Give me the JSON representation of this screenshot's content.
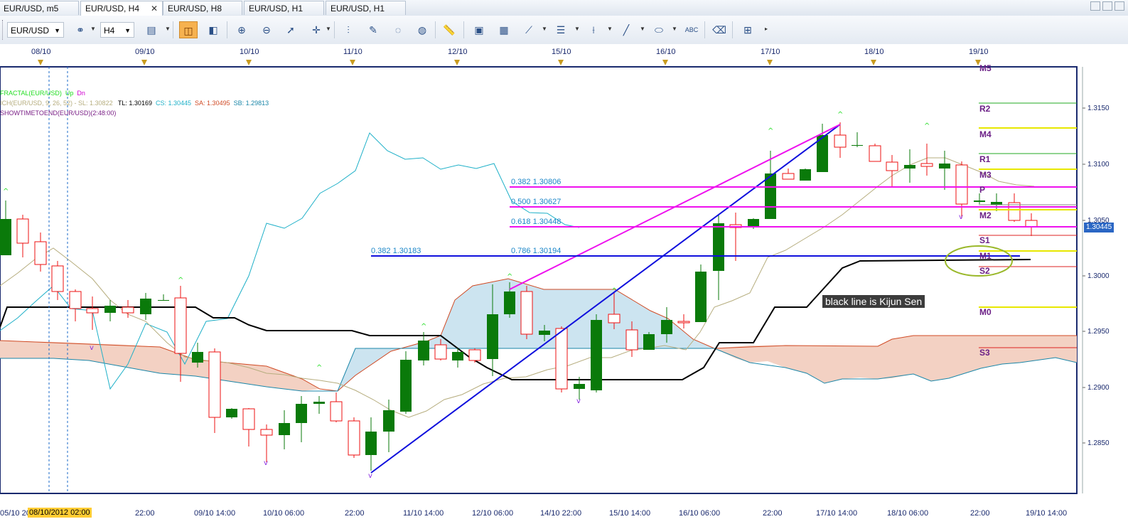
{
  "tabs": [
    {
      "label": "EUR/USD, m5",
      "active": false
    },
    {
      "label": "EUR/USD, H4",
      "active": true,
      "close": "✕"
    },
    {
      "label": "EUR/USD, H8",
      "active": false
    },
    {
      "label": "EUR/USD, H1",
      "active": false
    },
    {
      "label": "EUR/USD, H1",
      "active": false
    }
  ],
  "toolbar": {
    "symbol": "EUR/USD",
    "timeframe": "H4",
    "icons": [
      "link-icon",
      "chart-type-icon",
      "candles-icon",
      "bars-icon",
      "zoom-in-icon",
      "zoom-out-icon",
      "cursor-icon",
      "crosshair-icon",
      "period-separator-icon",
      "chart-properties-icon",
      "object-properties-icon",
      "globe-icon",
      "ruler-icon",
      "image-icon",
      "template-icon",
      "draw-tools-icon",
      "lines-icon",
      "fib-icon",
      "pen-icon",
      "ellipse-icon",
      "text-icon",
      "eraser-icon",
      "hierarchy-icon"
    ]
  },
  "indicators": {
    "fractal": {
      "name": "FRACTAL(EUR/USD)",
      "up": "Up",
      "dn": "Dn"
    },
    "ich": {
      "name": "ICH(EUR/USD, 9, 26, 52) - ",
      "sl": "SL: 1.30822",
      "tl": "TL: 1.30169",
      "cs": "CS: 1.30445",
      "sa": "SA: 1.30495",
      "sb": "SB: 1.29813"
    },
    "timer": "SHOWTIMETOEND(EUR/USD)(2:48:00)"
  },
  "top_dates": [
    "08/10",
    "09/10",
    "10/10",
    "11/10",
    "12/10",
    "15/10",
    "16/10",
    "17/10",
    "18/10",
    "19/10"
  ],
  "bottom_dates": [
    "05/10 20",
    "08/10/2012 02:00",
    "22:00",
    "09/10 14:00",
    "10/10 06:00",
    "22:00",
    "11/10 14:00",
    "12/10 06:00",
    "14/10 22:00",
    "15/10 14:00",
    "16/10 06:00",
    "22:00",
    "17/10 14:00",
    "18/10 06:00",
    "22:00",
    "19/10 14:00"
  ],
  "price_ticks": [
    "1.3150",
    "1.3100",
    "1.3050",
    "1.3000",
    "1.2950",
    "1.2900",
    "1.2850"
  ],
  "current_price": "1.30445",
  "fib_labels": [
    "0.382 1.30806",
    "0.500 1.30627",
    "0.618 1.30448",
    "0.382 1.30183",
    "0.786 1.30194"
  ],
  "pivot_labels": [
    "M5",
    "R2",
    "M4",
    "R1",
    "M3",
    "P",
    "M2",
    "S1",
    "M1",
    "S2",
    "M0",
    "S3"
  ],
  "annotation": "black line is Kijun Sen",
  "colors": {
    "bull": "#0a7a0a",
    "bear": "#ee1111",
    "tenkan": "#b6ad7e",
    "kijun": "#000000",
    "chikou": "#1eb0c8",
    "cloud_bear": "#f3d1c3",
    "cloud_bull": "#cce4f0",
    "fib": "#ee11ee",
    "trend": "#1010dd",
    "pivot_label": "#6b1f86"
  }
}
